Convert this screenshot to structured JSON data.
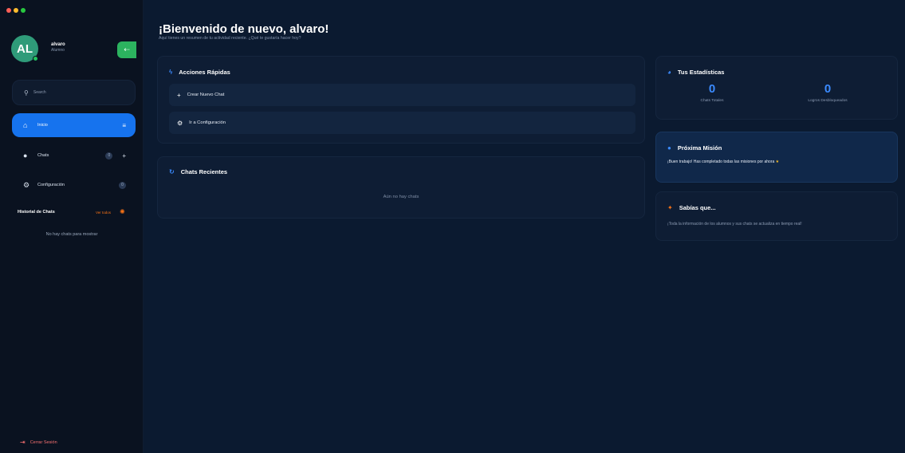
{
  "sidebar": {
    "user": {
      "initials": "AL",
      "name": "alvaro",
      "role": "Alumno"
    },
    "search": {
      "placeholder": "Search"
    },
    "nav": [
      {
        "label": "Inicio",
        "icon": "home-icon",
        "active": true
      },
      {
        "label": "Chats",
        "icon": "chat-bubble-icon",
        "badge": "0"
      },
      {
        "label": "Configuración",
        "icon": "gear-icon",
        "badge": "0"
      }
    ],
    "history": {
      "title": "Historial de Chats",
      "link": "Ver todos",
      "empty": "No hay chats para mostrar"
    },
    "signout": "Cerrar Sesión"
  },
  "main": {
    "title": "¡Bienvenido de nuevo, alvaro!",
    "subtitle": "Aquí tienes un resumen de tu actividad reciente. ¿Qué te gustaría hacer hoy?",
    "quick_actions": {
      "title": "Acciones Rápidas",
      "items": [
        {
          "label": "Crear Nuevo Chat",
          "icon": "plus-icon"
        },
        {
          "label": "Ir a Configuración",
          "icon": "gear-icon"
        }
      ]
    },
    "recent_chats": {
      "title": "Chats Recientes",
      "empty": "Aún no hay chats"
    },
    "stats": {
      "title": "Tus Estadísticas",
      "items": [
        {
          "value": "0",
          "label": "Chats Totales"
        },
        {
          "value": "0",
          "label": "Logros Desbloqueados"
        }
      ]
    },
    "mission": {
      "title": "Próxima Misión",
      "text": "¡Buen trabajo! Has completado todas las misiones por ahora"
    },
    "tip": {
      "title": "Sabías que...",
      "text": "¡Toda la información de los alumnos y sus chats se actualiza en tiempo real!"
    }
  },
  "colors": {
    "accent": "#1673ee",
    "avatar": "#2f9b79",
    "danger": "#f87171",
    "orange": "#f97316"
  }
}
